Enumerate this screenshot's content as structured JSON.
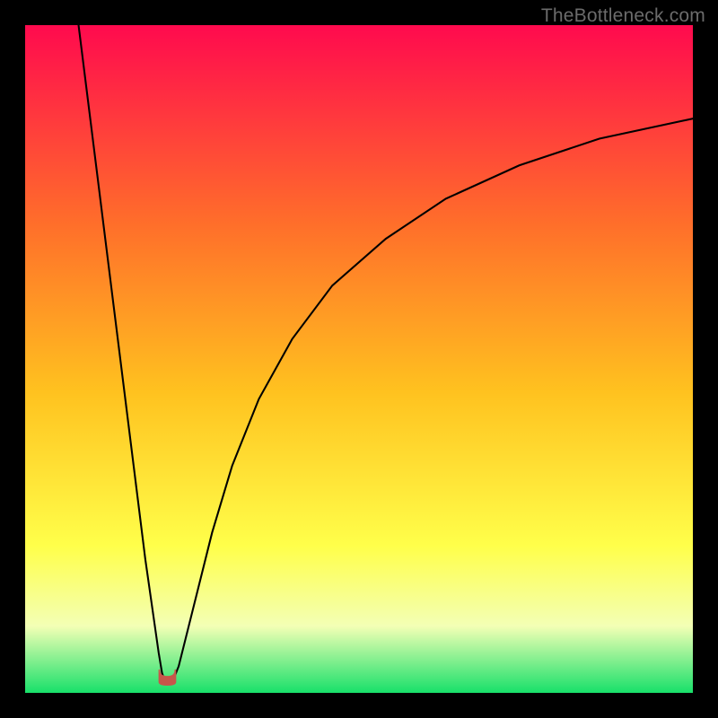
{
  "watermark": "TheBottleneck.com",
  "colors": {
    "top": "#ff0a4e",
    "mid1": "#ff6f2a",
    "mid2": "#ffc21f",
    "mid3": "#ffff4a",
    "pale": "#f3ffb5",
    "green": "#18e06a",
    "curve": "#000000",
    "spot": "#c7564a",
    "frame": "#000000"
  },
  "chart_data": {
    "type": "line",
    "title": "",
    "xlabel": "",
    "ylabel": "",
    "xlim": [
      0,
      100
    ],
    "ylim": [
      0,
      100
    ],
    "notes": "Two curves (left descending, right ascending) meeting near a minimum at x≈21 with a small red spot marking the base. Background is a vertical gradient from red (top) through orange/yellow to green (bottom). Axes are unlabeled.",
    "series": [
      {
        "name": "left-curve",
        "x": [
          8,
          10,
          12,
          14,
          16,
          18,
          19,
          20,
          20.5,
          21
        ],
        "y": [
          100,
          84,
          68,
          52,
          36,
          20,
          13,
          6,
          3,
          1.5
        ]
      },
      {
        "name": "right-curve",
        "x": [
          22,
          23,
          24,
          26,
          28,
          31,
          35,
          40,
          46,
          54,
          63,
          74,
          86,
          100
        ],
        "y": [
          1.5,
          4,
          8,
          16,
          24,
          34,
          44,
          53,
          61,
          68,
          74,
          79,
          83,
          86
        ]
      }
    ],
    "minimum_marker": {
      "x": 21.3,
      "y": 1.2,
      "width": 2.4,
      "height": 2.2
    }
  }
}
